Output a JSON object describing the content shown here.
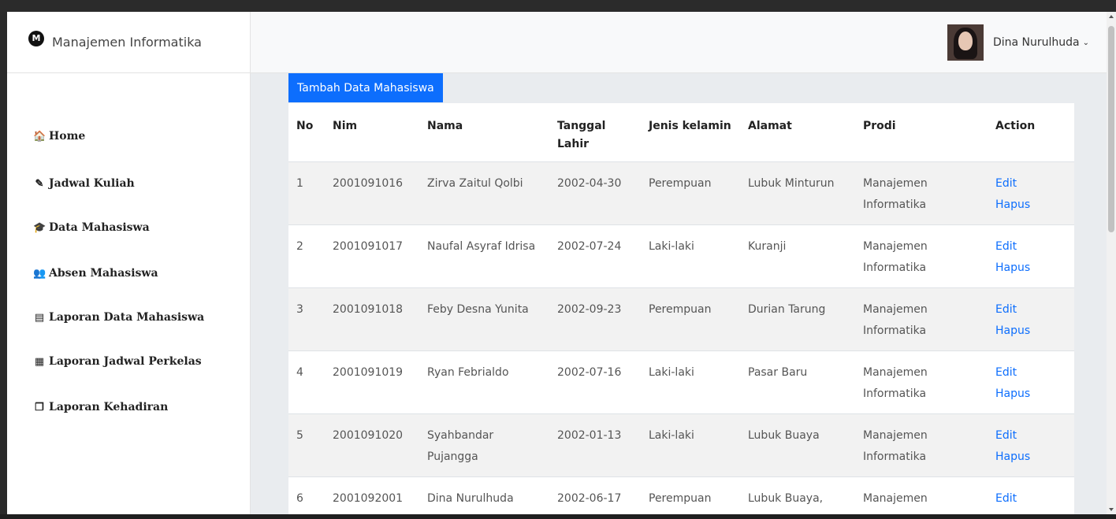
{
  "brand": {
    "title": "Manajemen Informatika",
    "logo_text": "M"
  },
  "user": {
    "name": "Dina Nurulhuda"
  },
  "sidebar": {
    "items": [
      {
        "label": "Home",
        "icon": "home-icon",
        "glyph": "🏠"
      },
      {
        "label": "Jadwal Kuliah",
        "icon": "edit-icon",
        "glyph": "✎"
      },
      {
        "label": "Data Mahasiswa",
        "icon": "graduation-cap-icon",
        "glyph": "🎓"
      },
      {
        "label": "Absen Mahasiswa",
        "icon": "users-icon",
        "glyph": "👥"
      },
      {
        "label": "Laporan Data Mahasiswa",
        "icon": "book-icon",
        "glyph": "▤"
      },
      {
        "label": "Laporan Jadwal Perkelas",
        "icon": "id-card-icon",
        "glyph": "▦"
      },
      {
        "label": "Laporan Kehadiran",
        "icon": "copy-icon",
        "glyph": "❐"
      }
    ]
  },
  "main": {
    "add_button": "Tambah Data Mahasiswa"
  },
  "table": {
    "headers": [
      "No",
      "Nim",
      "Nama",
      "Tanggal Lahir",
      "Jenis kelamin",
      "Alamat",
      "Prodi",
      "Action"
    ],
    "rows": [
      {
        "no": "1",
        "nim": "2001091016",
        "nama": "Zirva Zaitul Qolbi",
        "tgl": "2002-04-30",
        "jk": "Perempuan",
        "alamat": "Lubuk Minturun",
        "prodi": "Manajemen Informatika",
        "edit": "Edit",
        "hapus": "Hapus"
      },
      {
        "no": "2",
        "nim": "2001091017",
        "nama": "Naufal Asyraf Idrisa",
        "tgl": "2002-07-24",
        "jk": "Laki-laki",
        "alamat": "Kuranji",
        "prodi": "Manajemen Informatika",
        "edit": "Edit",
        "hapus": "Hapus"
      },
      {
        "no": "3",
        "nim": "2001091018",
        "nama": "Feby Desna Yunita",
        "tgl": "2002-09-23",
        "jk": "Perempuan",
        "alamat": "Durian Tarung",
        "prodi": "Manajemen Informatika",
        "edit": "Edit",
        "hapus": "Hapus"
      },
      {
        "no": "4",
        "nim": "2001091019",
        "nama": "Ryan Febrialdo",
        "tgl": "2002-07-16",
        "jk": "Laki-laki",
        "alamat": "Pasar Baru",
        "prodi": "Manajemen Informatika",
        "edit": "Edit",
        "hapus": "Hapus"
      },
      {
        "no": "5",
        "nim": "2001091020",
        "nama": "Syahbandar Pujangga",
        "tgl": "2002-01-13",
        "jk": "Laki-laki",
        "alamat": "Lubuk Buaya",
        "prodi": "Manajemen Informatika",
        "edit": "Edit",
        "hapus": "Hapus"
      },
      {
        "no": "6",
        "nim": "2001092001",
        "nama": "Dina Nurulhuda",
        "tgl": "2002-06-17",
        "jk": "Perempuan",
        "alamat": "Lubuk Buaya,",
        "prodi": "Manajemen",
        "edit": "Edit",
        "hapus": ""
      }
    ]
  },
  "colors": {
    "primary": "#0d6efd",
    "link": "#0d6efd",
    "stripe": "#f2f2f2",
    "page_bg": "#e9ecef"
  }
}
